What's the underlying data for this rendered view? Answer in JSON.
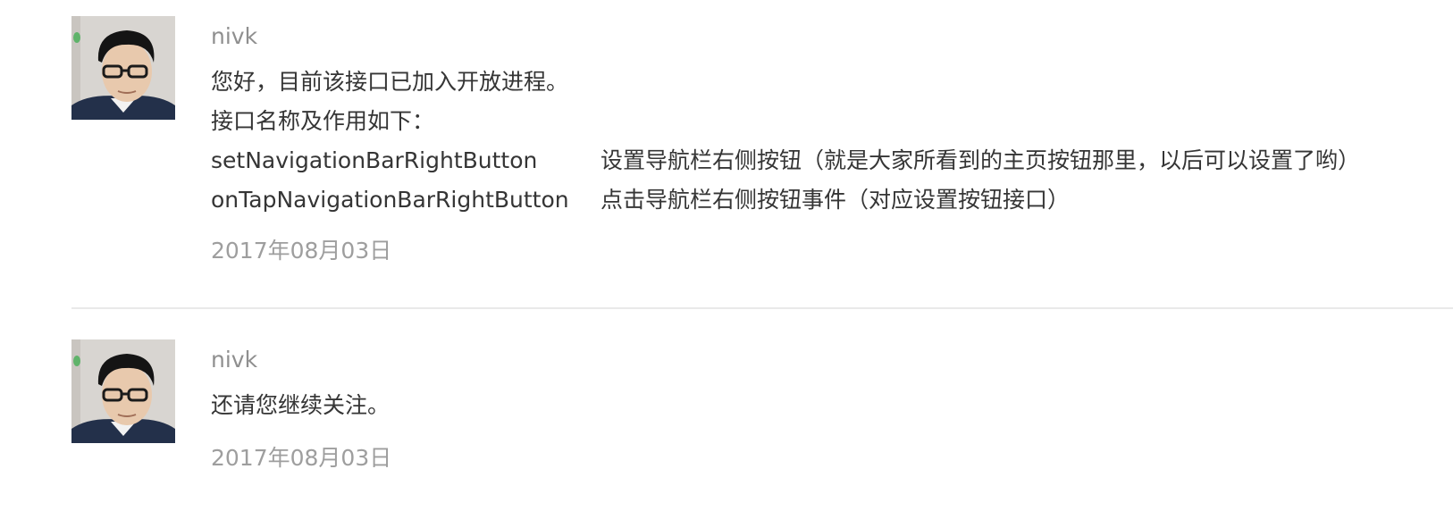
{
  "comments": [
    {
      "author": "nivk",
      "lines": [
        "您好，目前该接口已加入开放进程。",
        "接口名称及作用如下："
      ],
      "apis": [
        {
          "name": "setNavigationBarRightButton",
          "desc": "设置导航栏右侧按钮（就是大家所看到的主页按钮那里，以后可以设置了哟）"
        },
        {
          "name": "onTapNavigationBarRightButton",
          "desc": "点击导航栏右侧按钮事件（对应设置按钮接口）"
        }
      ],
      "date": "2017年08月03日",
      "avatar_icon": "user-avatar-photo"
    },
    {
      "author": "nivk",
      "lines": [
        "还请您继续关注。"
      ],
      "date": "2017年08月03日",
      "avatar_icon": "user-avatar-photo"
    }
  ]
}
